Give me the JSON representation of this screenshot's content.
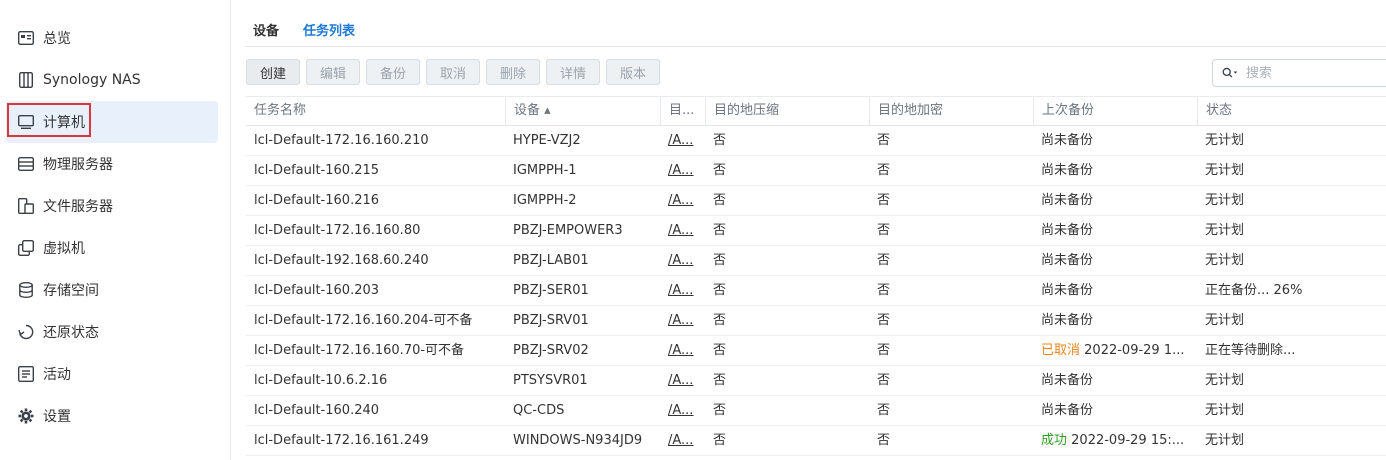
{
  "sidebar": {
    "items": [
      {
        "label": "总览",
        "icon": "overview-icon"
      },
      {
        "label": "Synology NAS",
        "icon": "nas-icon"
      },
      {
        "label": "计算机",
        "icon": "computer-icon"
      },
      {
        "label": "物理服务器",
        "icon": "server-icon"
      },
      {
        "label": "文件服务器",
        "icon": "file-server-icon"
      },
      {
        "label": "虚拟机",
        "icon": "vm-icon"
      },
      {
        "label": "存储空间",
        "icon": "storage-icon"
      },
      {
        "label": "还原状态",
        "icon": "restore-icon"
      },
      {
        "label": "活动",
        "icon": "activity-icon"
      },
      {
        "label": "设置",
        "icon": "gear-icon"
      }
    ],
    "active_index": 2
  },
  "tabs": [
    {
      "label": "设备",
      "active": false
    },
    {
      "label": "任务列表",
      "active": true
    }
  ],
  "toolbar": {
    "create": "创建",
    "edit": "编辑",
    "backup": "备份",
    "cancel": "取消",
    "delete": "删除",
    "details": "详情",
    "version": "版本"
  },
  "search": {
    "placeholder": "搜索"
  },
  "table": {
    "headers": {
      "task": "任务名称",
      "device": "设备 ▴",
      "dest": "目...",
      "compress": "目的地压缩",
      "encrypt": "目的地加密",
      "last_backup": "上次备份",
      "status": "状态"
    },
    "rows": [
      {
        "task": "lcl-Default-172.16.160.210",
        "device": "HYPE-VZJ2",
        "dest": "/A...",
        "compress": "否",
        "encrypt": "否",
        "last_prefix": "",
        "last": "尚未备份",
        "status": "无计划"
      },
      {
        "task": "lcl-Default-160.215",
        "device": "IGMPPH-1",
        "dest": "/A...",
        "compress": "否",
        "encrypt": "否",
        "last_prefix": "",
        "last": "尚未备份",
        "status": "无计划"
      },
      {
        "task": "lcl-Default-160.216",
        "device": "IGMPPH-2",
        "dest": "/A...",
        "compress": "否",
        "encrypt": "否",
        "last_prefix": "",
        "last": "尚未备份",
        "status": "无计划"
      },
      {
        "task": "lcl-Default-172.16.160.80",
        "device": "PBZJ-EMPOWER3",
        "dest": "/A...",
        "compress": "否",
        "encrypt": "否",
        "last_prefix": "",
        "last": "尚未备份",
        "status": "无计划"
      },
      {
        "task": "lcl-Default-192.168.60.240",
        "device": "PBZJ-LAB01",
        "dest": "/A...",
        "compress": "否",
        "encrypt": "否",
        "last_prefix": "",
        "last": "尚未备份",
        "status": "无计划"
      },
      {
        "task": "lcl-Default-160.203",
        "device": "PBZJ-SER01",
        "dest": "/A...",
        "compress": "否",
        "encrypt": "否",
        "last_prefix": "",
        "last": "尚未备份",
        "status": "正在备份... 26%"
      },
      {
        "task": "lcl-Default-172.16.160.204-可不备",
        "device": "PBZJ-SRV01",
        "dest": "/A...",
        "compress": "否",
        "encrypt": "否",
        "last_prefix": "",
        "last": "尚未备份",
        "status": "无计划"
      },
      {
        "task": "lcl-Default-172.16.160.70-可不备",
        "device": "PBZJ-SRV02",
        "dest": "/A...",
        "compress": "否",
        "encrypt": "否",
        "last_prefix": "已取消",
        "last_prefix_color": "#e8861a",
        "last": " 2022-09-29 1...",
        "status": "正在等待删除..."
      },
      {
        "task": "lcl-Default-10.6.2.16",
        "device": "PTSYSVR01",
        "dest": "/A...",
        "compress": "否",
        "encrypt": "否",
        "last_prefix": "",
        "last": "尚未备份",
        "status": "无计划"
      },
      {
        "task": "lcl-Default-160.240",
        "device": "QC-CDS",
        "dest": "/A...",
        "compress": "否",
        "encrypt": "否",
        "last_prefix": "",
        "last": "尚未备份",
        "status": "无计划"
      },
      {
        "task": "lcl-Default-172.16.161.249",
        "device": "WINDOWS-N934JD9",
        "dest": "/A...",
        "compress": "否",
        "encrypt": "否",
        "last_prefix": "成功",
        "last_prefix_color": "#2ea121",
        "last": " 2022-09-29 15:...",
        "status": "无计划"
      }
    ]
  }
}
